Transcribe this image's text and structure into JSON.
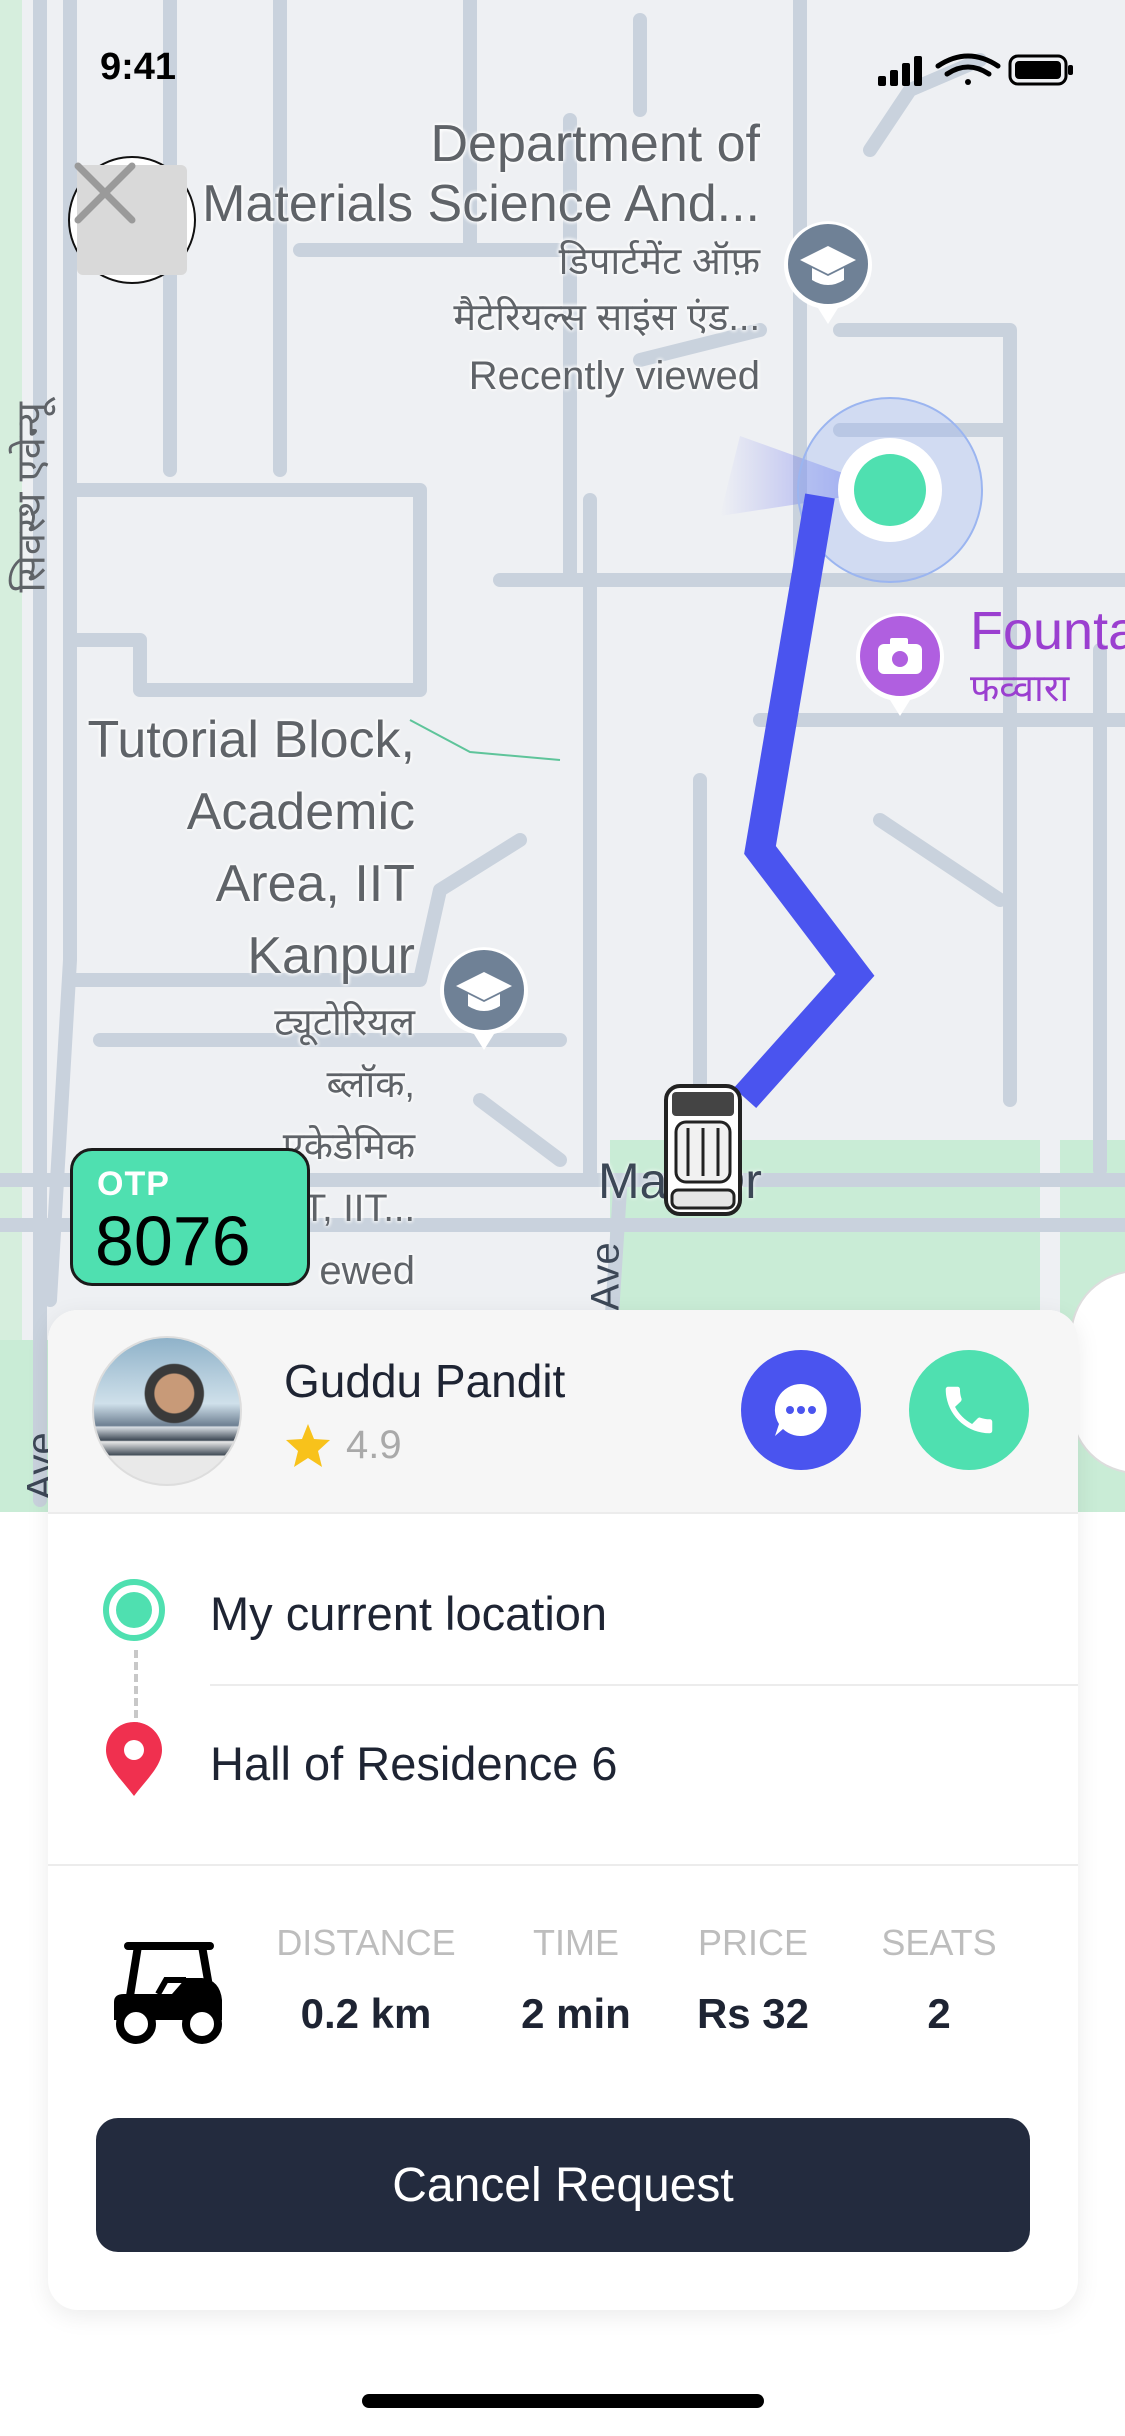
{
  "status_bar": {
    "time": "9:41"
  },
  "map": {
    "labels": {
      "dept_en_1": "Department of",
      "dept_en_2": "Materials Science And...",
      "dept_hi_1": "डिपार्टमेंट ऑफ़",
      "dept_hi_2": "मैटेरियल्स साइंस एंड...",
      "dept_recent": "Recently viewed",
      "fountain_en": "Founta",
      "fountain_hi": "फव्वारा",
      "tutorial_1": "Tutorial Block,",
      "tutorial_2": "Academic",
      "tutorial_3": "Area, IIT",
      "tutorial_4": "Kanpur",
      "tutorial_hi_1": "ट्यूटोरियल",
      "tutorial_hi_2": "ब्लॉक,",
      "tutorial_hi_3": "एकेडेमिक",
      "tutorial_hi_4": "T, IIT...",
      "tutorial_recent": "ewed",
      "road_left": "सिवस्थ एवेन्यू",
      "road_main": "Ma   Dr",
      "road_ave_vertical": "Ave",
      "road_ave_left": "Ave"
    }
  },
  "otp": {
    "label": "OTP",
    "code": "8076"
  },
  "driver": {
    "name": "Guddu Pandit",
    "rating": "4.9"
  },
  "trip": {
    "pickup": "My current location",
    "dropoff": "Hall of Residence 6",
    "stats": [
      {
        "label": "DISTANCE",
        "value": "0.2 km"
      },
      {
        "label": "TIME",
        "value": "2 min"
      },
      {
        "label": "PRICE",
        "value": "Rs 32"
      },
      {
        "label": "SEATS",
        "value": "2"
      }
    ]
  },
  "actions": {
    "cancel_label": "Cancel Request"
  },
  "icons": [
    "close-icon",
    "chat-icon",
    "phone-icon",
    "star-icon",
    "pickup-dot-icon",
    "destination-pin-icon",
    "golf-cart-icon",
    "graduation-cap-icon",
    "camera-icon",
    "vehicle-icon",
    "signal-icon",
    "wifi-icon",
    "battery-icon"
  ],
  "colors": {
    "accent_green": "#4fe0b0",
    "route_blue": "#4a54ef",
    "dark_button": "#232b3e",
    "pin_red": "#f0304f",
    "fountain_purple": "#b05fe0"
  }
}
